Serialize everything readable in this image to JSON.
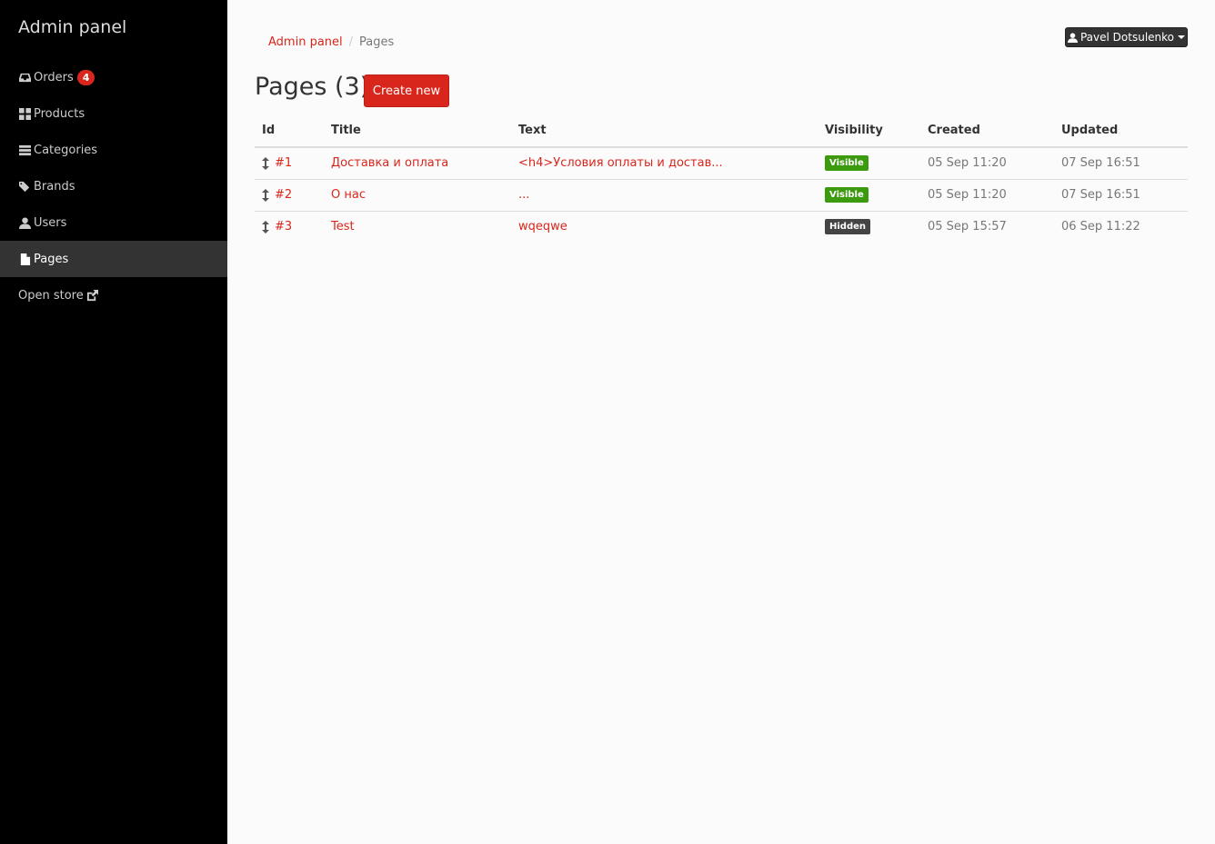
{
  "app": {
    "title": "Admin panel"
  },
  "sidebar": {
    "items": [
      {
        "label": "Orders",
        "badge": "4",
        "icon": "inbox-icon"
      },
      {
        "label": "Products",
        "icon": "th-large-icon"
      },
      {
        "label": "Categories",
        "icon": "tasks-icon"
      },
      {
        "label": "Brands",
        "icon": "tags-icon"
      },
      {
        "label": "Users",
        "icon": "user-icon"
      },
      {
        "label": "Pages",
        "icon": "file-icon",
        "active": true
      },
      {
        "label": "Open store",
        "icon": "external-link-icon"
      }
    ]
  },
  "breadcrumb": {
    "root": "Admin panel",
    "current": "Pages"
  },
  "user": {
    "name": "Pavel Dotsulenko"
  },
  "header": {
    "title": "Pages (3)",
    "create_label": "Create new"
  },
  "table": {
    "columns": [
      "Id",
      "Title",
      "Text",
      "Visibility",
      "Created",
      "Updated"
    ],
    "rows": [
      {
        "id": "#1",
        "title": "Доставка и оплата",
        "text": "<h4>Условия оплаты и достав...",
        "visibility": "Visible",
        "created": "05 Sep 11:20",
        "updated": "07 Sep 16:51"
      },
      {
        "id": "#2",
        "title": "О нас",
        "text": "...",
        "visibility": "Visible",
        "created": "05 Sep 11:20",
        "updated": "07 Sep 16:51"
      },
      {
        "id": "#3",
        "title": "Test",
        "text": "wqeqwe",
        "visibility": "Hidden",
        "created": "05 Sep 15:57",
        "updated": "06 Sep 11:22"
      }
    ]
  },
  "colors": {
    "accent": "#d9261c",
    "visible": "#3c9a0e",
    "hidden": "#444444",
    "sidebar": "#000000",
    "sidebar_active": "#333333"
  }
}
